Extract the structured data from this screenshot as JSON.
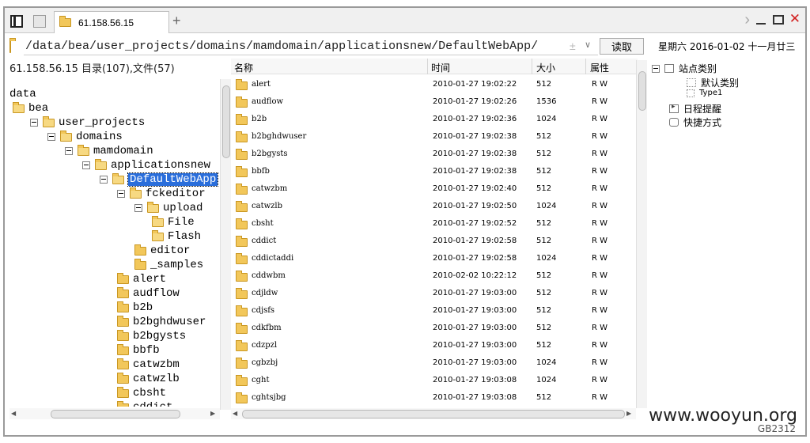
{
  "tab": {
    "label": "61.158.56.15",
    "add": "+"
  },
  "address": {
    "path": "/data/bea/user_projects/domains/mamdomain/applicationsnew/DefaultWebApp/",
    "plus": "±",
    "dropdown": "∨"
  },
  "read_button": "读取",
  "date_label": "星期六 2016-01-02 十一月廿三",
  "left_info": "61.158.56.15    目录(107),文件(57)",
  "tree": [
    {
      "label": "data",
      "level": 0,
      "toggle": false,
      "folder": false,
      "open": false,
      "selected": false
    },
    {
      "label": "bea",
      "level": 0,
      "toggle": false,
      "folder": true,
      "open": true,
      "selected": false
    },
    {
      "label": "user_projects",
      "level": 1,
      "toggle": true,
      "folder": true,
      "open": true,
      "selected": false
    },
    {
      "label": "domains",
      "level": 2,
      "toggle": true,
      "folder": true,
      "open": true,
      "selected": false
    },
    {
      "label": "mamdomain",
      "level": 3,
      "toggle": true,
      "folder": true,
      "open": true,
      "selected": false
    },
    {
      "label": "applicationsnew",
      "level": 4,
      "toggle": true,
      "folder": true,
      "open": true,
      "selected": false
    },
    {
      "label": "DefaultWebApp",
      "level": 5,
      "toggle": true,
      "folder": true,
      "open": true,
      "selected": true
    },
    {
      "label": "fckeditor",
      "level": 6,
      "toggle": true,
      "folder": true,
      "open": true,
      "selected": false
    },
    {
      "label": "upload",
      "level": 7,
      "toggle": true,
      "folder": true,
      "open": true,
      "selected": false
    },
    {
      "label": "File",
      "level": 8,
      "toggle": false,
      "folder": true,
      "open": true,
      "selected": false
    },
    {
      "label": "Flash",
      "level": 8,
      "toggle": false,
      "folder": true,
      "open": true,
      "selected": false
    },
    {
      "label": "editor",
      "level": 7,
      "toggle": false,
      "folder": true,
      "open": false,
      "selected": false
    },
    {
      "label": "_samples",
      "level": 7,
      "toggle": false,
      "folder": true,
      "open": false,
      "selected": false
    },
    {
      "label": "alert",
      "level": 6,
      "toggle": false,
      "folder": true,
      "open": false,
      "selected": false
    },
    {
      "label": "audflow",
      "level": 6,
      "toggle": false,
      "folder": true,
      "open": false,
      "selected": false
    },
    {
      "label": "b2b",
      "level": 6,
      "toggle": false,
      "folder": true,
      "open": false,
      "selected": false
    },
    {
      "label": "b2bghdwuser",
      "level": 6,
      "toggle": false,
      "folder": true,
      "open": false,
      "selected": false
    },
    {
      "label": "b2bgysts",
      "level": 6,
      "toggle": false,
      "folder": true,
      "open": false,
      "selected": false
    },
    {
      "label": "bbfb",
      "level": 6,
      "toggle": false,
      "folder": true,
      "open": false,
      "selected": false
    },
    {
      "label": "catwzbm",
      "level": 6,
      "toggle": false,
      "folder": true,
      "open": false,
      "selected": false
    },
    {
      "label": "catwzlb",
      "level": 6,
      "toggle": false,
      "folder": true,
      "open": false,
      "selected": false
    },
    {
      "label": "cbsht",
      "level": 6,
      "toggle": false,
      "folder": true,
      "open": false,
      "selected": false
    },
    {
      "label": "cddict",
      "level": 6,
      "toggle": false,
      "folder": true,
      "open": false,
      "selected": false
    }
  ],
  "columns": {
    "name": "名称",
    "time": "时间",
    "size": "大小",
    "attr": "属性"
  },
  "files": [
    {
      "name": "alert",
      "time": "2010-01-27 19:02:22",
      "size": "512",
      "attr": "R W"
    },
    {
      "name": "audflow",
      "time": "2010-01-27 19:02:26",
      "size": "1536",
      "attr": "R W"
    },
    {
      "name": "b2b",
      "time": "2010-01-27 19:02:36",
      "size": "1024",
      "attr": "R W"
    },
    {
      "name": "b2bghdwuser",
      "time": "2010-01-27 19:02:38",
      "size": "512",
      "attr": "R W"
    },
    {
      "name": "b2bgysts",
      "time": "2010-01-27 19:02:38",
      "size": "512",
      "attr": "R W"
    },
    {
      "name": "bbfb",
      "time": "2010-01-27 19:02:38",
      "size": "512",
      "attr": "R W"
    },
    {
      "name": "catwzbm",
      "time": "2010-01-27 19:02:40",
      "size": "512",
      "attr": "R W"
    },
    {
      "name": "catwzlb",
      "time": "2010-01-27 19:02:50",
      "size": "1024",
      "attr": "R W"
    },
    {
      "name": "cbsht",
      "time": "2010-01-27 19:02:52",
      "size": "512",
      "attr": "R W"
    },
    {
      "name": "cddict",
      "time": "2010-01-27 19:02:58",
      "size": "512",
      "attr": "R W"
    },
    {
      "name": "cddictaddi",
      "time": "2010-01-27 19:02:58",
      "size": "1024",
      "attr": "R W"
    },
    {
      "name": "cddwbm",
      "time": "2010-02-02 10:22:12",
      "size": "512",
      "attr": "R W"
    },
    {
      "name": "cdjldw",
      "time": "2010-01-27 19:03:00",
      "size": "512",
      "attr": "R W"
    },
    {
      "name": "cdjsfs",
      "time": "2010-01-27 19:03:00",
      "size": "512",
      "attr": "R W"
    },
    {
      "name": "cdkfbm",
      "time": "2010-01-27 19:03:00",
      "size": "512",
      "attr": "R W"
    },
    {
      "name": "cdzpzl",
      "time": "2010-01-27 19:03:00",
      "size": "512",
      "attr": "R W"
    },
    {
      "name": "cgbzbj",
      "time": "2010-01-27 19:03:00",
      "size": "1024",
      "attr": "R W"
    },
    {
      "name": "cght",
      "time": "2010-01-27 19:03:08",
      "size": "1024",
      "attr": "R W"
    },
    {
      "name": "cghtsjbg",
      "time": "2010-01-27 19:03:08",
      "size": "512",
      "attr": "R W"
    }
  ],
  "right_panel": {
    "site_category": "站点类别",
    "default_category": "默认类别",
    "type1": "Type1",
    "schedule": "日程提醒",
    "shortcut": "快捷方式"
  },
  "watermark": "www.wooyun.org",
  "encoding": "GB2312"
}
